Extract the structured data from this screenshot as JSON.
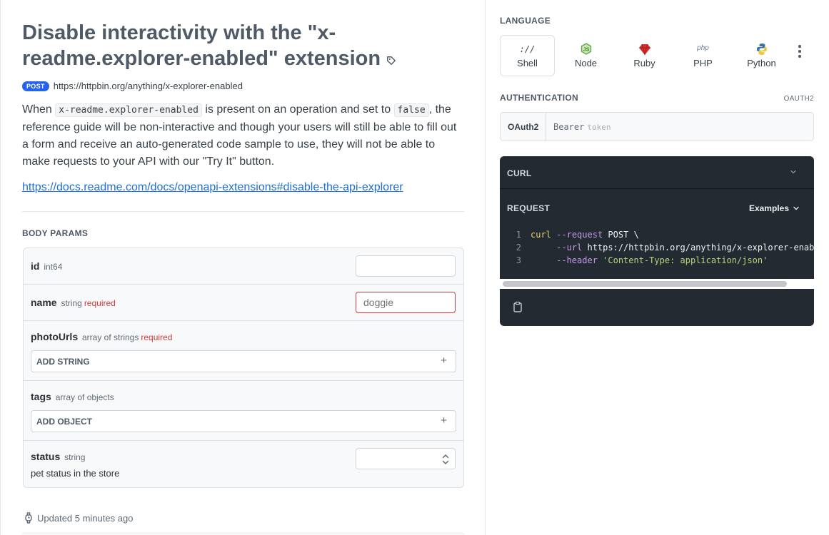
{
  "endpoint": {
    "title": "Disable interactivity with the \"x-readme.explorer-enabled\" extension",
    "method": "POST",
    "url": "https://httpbin.org/anything/x-explorer-enabled",
    "description": {
      "p1": "When ",
      "code1": "x-readme.explorer-enabled",
      "p2": " is present on an operation and set to ",
      "code2": "false",
      "p3": ", the reference guide will be non-interactive and though your users will still be able to fill out a form and receive an auto-generated code sample to use, they will not be able to make requests to your API with our \"Try It\" button."
    },
    "doc_link": "https://docs.readme.com/docs/openapi-extensions#disable-the-api-explorer"
  },
  "body_params": {
    "heading": "BODY PARAMS",
    "params": [
      {
        "name": "id",
        "type": "int64",
        "required": "",
        "value": "",
        "placeholder": ""
      },
      {
        "name": "name",
        "type": "string",
        "required": "required",
        "value": "",
        "placeholder": "doggie"
      },
      {
        "name": "photoUrls",
        "type": "array of strings",
        "required": "required",
        "button": "ADD STRING"
      },
      {
        "name": "tags",
        "type": "array of objects",
        "required": "",
        "button": "ADD OBJECT"
      },
      {
        "name": "status",
        "type": "string",
        "required": "",
        "description": "pet status in the store",
        "selected": ""
      }
    ]
  },
  "footer": {
    "updated": "Updated 5 minutes ago"
  },
  "language": {
    "heading": "LANGUAGE",
    "items": [
      {
        "label": "Shell",
        "icon": "shell-icon",
        "active": true
      },
      {
        "label": "Node",
        "icon": "node-icon",
        "active": false
      },
      {
        "label": "Ruby",
        "icon": "ruby-icon",
        "active": false
      },
      {
        "label": "PHP",
        "icon": "php-icon",
        "active": false
      },
      {
        "label": "Python",
        "icon": "python-icon",
        "active": false
      }
    ],
    "shell_glyph": "://",
    "php_glyph": "php"
  },
  "authentication": {
    "heading": "AUTHENTICATION",
    "scheme_badge": "OAUTH2",
    "type": "OAuth2",
    "prefix": "Bearer",
    "placeholder": "token"
  },
  "code_panel": {
    "title": "CURL",
    "request_heading": "REQUEST",
    "examples_label": "Examples",
    "lines": [
      {
        "n": "1",
        "cmd": "curl",
        "flag": "--request",
        "arg": "POST \\"
      },
      {
        "n": "2",
        "flag": "--url",
        "arg": "https://httpbin.org/anything/x-explorer-enabled \\"
      },
      {
        "n": "3",
        "flag": "--header",
        "str": "'Content-Type: application/json'"
      }
    ]
  },
  "colors": {
    "accent": "#2563eb",
    "link": "#1f6fd6",
    "required": "#d13a3a",
    "code_bg": "#242a31"
  }
}
